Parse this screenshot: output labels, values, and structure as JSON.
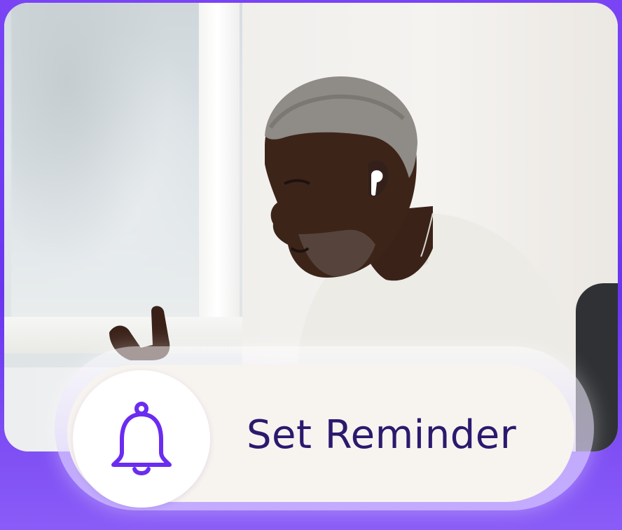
{
  "reminder": {
    "label": "Set Reminder",
    "icon": "bell-icon"
  },
  "colors": {
    "background": "#6d3bf0",
    "pill": "#f7f3ef",
    "label_text": "#2a1a6e",
    "icon": "#6a2cf0"
  }
}
